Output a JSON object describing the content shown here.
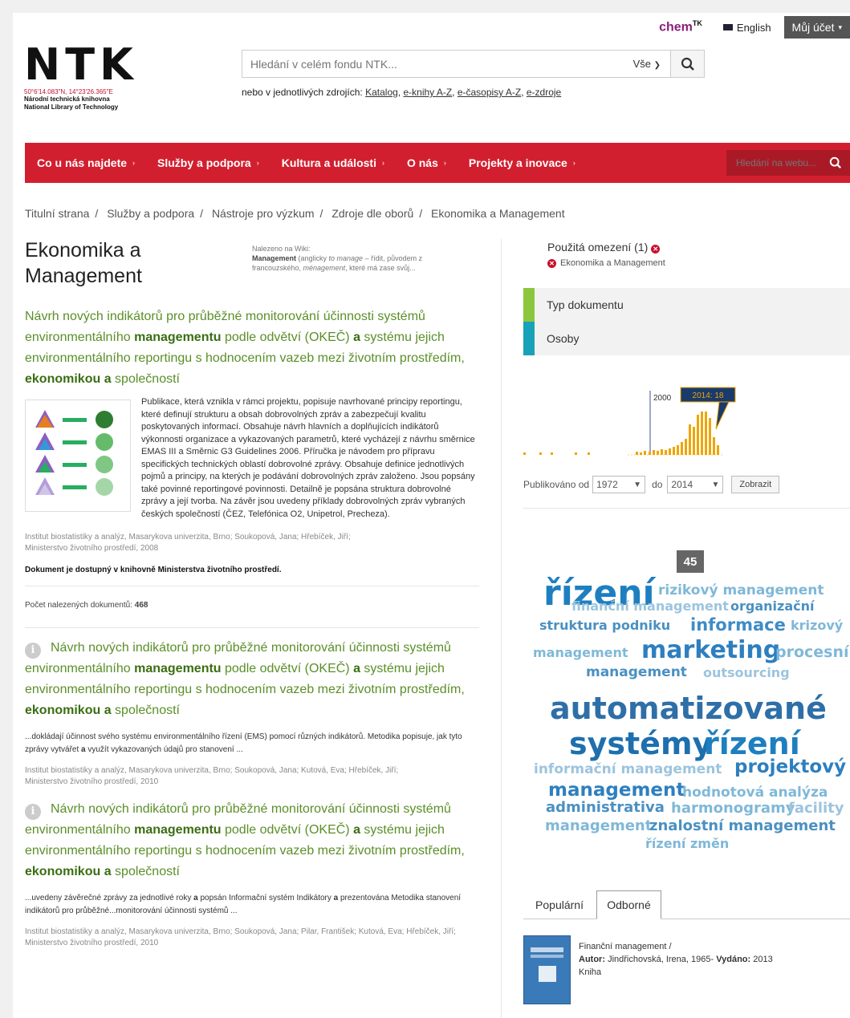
{
  "header": {
    "logo": "NTK",
    "coords": "50°6'14.083\"N, 14°23'26.365\"E",
    "library_cz": "Národní technická knihovna",
    "library_en": "National Library of Technology",
    "chem": "chem",
    "chem_sup": "TK",
    "language": "English",
    "account": "Můj účet",
    "search_placeholder": "Hledání v celém fondu NTK...",
    "search_scope": "Vše",
    "sources_prefix": "nebo v jednotlivých zdrojích:",
    "sources": [
      "Katalog",
      "e-knihy A-Z",
      "e-časopisy A-Z",
      "e-zdroje"
    ]
  },
  "nav": {
    "items": [
      "Co u nás najdete",
      "Služby a podpora",
      "Kultura a události",
      "O nás",
      "Projekty a inovace"
    ],
    "search_placeholder": "Hledání na webu..."
  },
  "breadcrumb": [
    "Titulní strana",
    "Služby a podpora",
    "Nástroje pro výzkum",
    "Zdroje dle oborů",
    "Ekonomika a Management"
  ],
  "main": {
    "title": "Ekonomika a Management",
    "wiki_label": "Nalezeno na Wiki:",
    "wiki_term": "Management",
    "wiki_text_a": " (anglicky ",
    "wiki_italic_a": "to manage",
    "wiki_text_b": " – řídit, původem z francouzského, ",
    "wiki_italic_b": "ménagement",
    "wiki_text_c": ", které má zase svůj...",
    "featured": {
      "title_a": "Návrh nových indikátorů pro průběžné monitorování účinnosti systémů environmentálního ",
      "title_b": "managementu",
      "title_c": " podle odvětví (OKEČ) ",
      "title_d": "a",
      "title_e": " systému jejich environmentálního reportingu s hodnocením vazeb mezi životním prostředím, ",
      "title_f": "ekonomikou",
      "title_g": " ",
      "title_h": "a",
      "title_i": " společností",
      "body": "Publikace, která vznikla v rámci projektu, popisuje navrhované principy reportingu, které definují strukturu a obsah dobrovolných zpráv a zabezpečují kvalitu poskytovaných informací. Obsahuje návrh hlavních a doplňujících indikátorů výkonnosti organizace a vykazovaných parametrů, které vycházejí z návrhu směrnice EMAS III a Směrnic G3 Guidelines 2006. Příručka je návodem pro přípravu specifických technických oblastí dobrovolné zprávy. Obsahuje definice jednotlivých pojmů a principy, na kterých je podávání dobrovolných zpráv založeno. Jsou popsány také povinné reportingové povinnosti. Detailně je popsána struktura dobrovolné zprávy a její tvorba. Na závěr jsou uvedeny příklady dobrovolných zpráv vybraných českých společností (ČEZ, Telefónica O2, Unipetrol, Precheza).",
      "meta1": "Institut biostatistiky a analýz, Masarykova univerzita, Brno; Soukopová, Jana; Hřebíček, Jiří;",
      "meta2": "Ministerstvo životního prostředí, 2008",
      "availability": "Dokument je dostupný v knihovně Ministerstva životního prostředí."
    },
    "count_label": "Počet nalezených dokumentů:",
    "count": "468",
    "results": [
      {
        "body_a": "...dokládají účinnost svého systému environmentálního řízení (EMS) pomocí různých indikátorů. Metodika popisuje, jak tyto zprávy vytvářet ",
        "body_b": "a",
        "body_c": " využít vykazovaných údajů pro stanovení ...",
        "meta1": "Institut biostatistiky a analýz, Masarykova univerzita, Brno; Soukopová, Jana; Kutová, Eva; Hřebíček, Jiří;",
        "meta2": "Ministerstvo životního prostředí, 2010"
      },
      {
        "body_a": "...uvedeny závěrečné zprávy za jednotlivé roky ",
        "body_b": "a",
        "body_c": " popsán Informační systém Indikátory ",
        "body_d": "a",
        "body_e": " prezentována Metodika stanovení indikátorů pro průběžné...monitorování účinnosti systémů ...",
        "meta1": "Institut biostatistiky a analýz, Masarykova univerzita, Brno; Soukopová, Jana; Pilar, František; Kutová, Eva; Hřebíček, Jiří;",
        "meta2": "Ministerstvo životního prostředí, 2010"
      }
    ]
  },
  "sidebar": {
    "used_label": "Použitá omezení (1)",
    "used_item": "Ekonomika a Management",
    "facets": [
      {
        "label": "Typ dokumentu",
        "color": "#8cc63f"
      },
      {
        "label": "Osoby",
        "color": "#17a2b8"
      }
    ],
    "histogram_marker": "2000",
    "histogram_tooltip": "2014: 18",
    "pub_from_label": "Publikováno od",
    "pub_from": "1972",
    "pub_to_label": "do",
    "pub_to": "2014",
    "show_button": "Zobrazit",
    "cloud_badge": "45",
    "cloud": [
      "řízení",
      "rizikový management",
      "finanční management",
      "organizační",
      "struktura podniku",
      "informace",
      "krizový",
      "management",
      "marketing",
      "procesní",
      "management",
      "outsourcing",
      "automatizované",
      "systémy",
      "řízení",
      "informační management",
      "projektový",
      "management",
      "hodnotová analýza",
      "administrativa",
      "harmonogramy",
      "facility",
      "management",
      "znalostní management",
      "řízení změn"
    ],
    "tabs": [
      "Populární",
      "Odborné"
    ],
    "book_title": "Finanční management /",
    "book_author_label": "Autor:",
    "book_author": "Jindřichovská, Irena, 1965-",
    "book_issued_label": "Vydáno:",
    "book_issued": "2013",
    "book_type": "Kniha"
  }
}
